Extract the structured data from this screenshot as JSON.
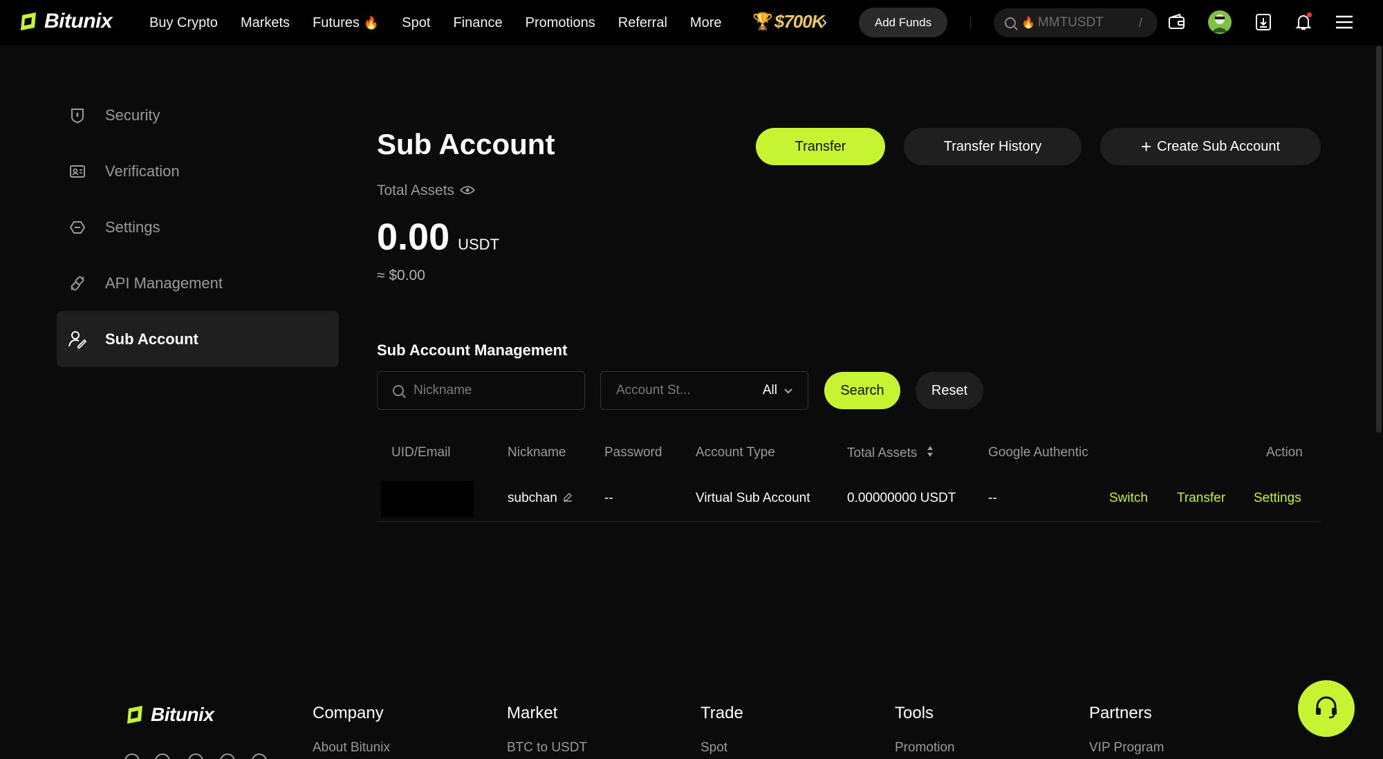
{
  "brand": {
    "name": "Bitunix",
    "accent": "#c6f432"
  },
  "topnav": {
    "items": [
      {
        "label": "Buy Crypto"
      },
      {
        "label": "Markets"
      },
      {
        "label": "Futures"
      },
      {
        "label": "Spot"
      },
      {
        "label": "Finance"
      },
      {
        "label": "Promotions"
      },
      {
        "label": "Referral"
      },
      {
        "label": "More"
      }
    ],
    "promo_amount": "$700K",
    "add_funds": "Add Funds",
    "search_value": "MMTUSDT",
    "search_shortcut": "/"
  },
  "sidebar": {
    "items": [
      {
        "label": "Security",
        "icon": "shield-icon"
      },
      {
        "label": "Verification",
        "icon": "id-card-icon"
      },
      {
        "label": "Settings",
        "icon": "settings-icon"
      },
      {
        "label": "API Management",
        "icon": "api-link-icon"
      },
      {
        "label": "Sub Account",
        "icon": "sub-account-icon",
        "active": true
      }
    ]
  },
  "main": {
    "title": "Sub Account",
    "buttons": {
      "transfer": "Transfer",
      "transfer_history": "Transfer History",
      "create_sub_account": "Create Sub Account"
    },
    "total_assets_label": "Total Assets",
    "total_assets_value": "0.00",
    "total_assets_unit": "USDT",
    "total_assets_usd": "≈ $0.00"
  },
  "management": {
    "title": "Sub Account Management",
    "nickname_placeholder": "Nickname",
    "status_placeholder": "Account St...",
    "status_value": "All",
    "search_button": "Search",
    "reset_button": "Reset",
    "columns": [
      "UID/Email",
      "Nickname",
      "Password",
      "Account Type",
      "Total Assets",
      "Google Authentic",
      "Action"
    ],
    "rows": [
      {
        "nickname": "subchan",
        "password": "--",
        "account_type": "Virtual Sub Account",
        "total_assets": "0.00000000 USDT",
        "google_auth": "--",
        "actions": [
          "Switch",
          "Transfer",
          "Settings"
        ]
      }
    ]
  },
  "footer": {
    "brand": "Bitunix",
    "columns": [
      {
        "title": "Company",
        "first_link": "About Bitunix"
      },
      {
        "title": "Market",
        "first_link": "BTC to USDT"
      },
      {
        "title": "Trade",
        "first_link": "Spot"
      },
      {
        "title": "Tools",
        "first_link": "Promotion"
      },
      {
        "title": "Partners",
        "first_link": "VIP Program"
      }
    ]
  }
}
